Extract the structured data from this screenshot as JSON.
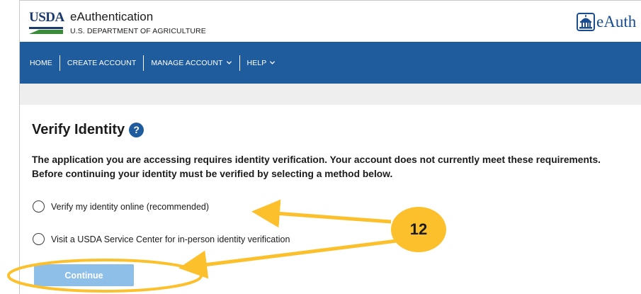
{
  "header": {
    "logo_text": "USDA",
    "app_title": "eAuthentication",
    "department": "U.S. DEPARTMENT OF AGRICULTURE",
    "brand_text": "eAuth",
    "brand_icon": "capitol-dome-icon"
  },
  "nav": {
    "items": [
      {
        "label": "HOME",
        "has_dropdown": false
      },
      {
        "label": "CREATE ACCOUNT",
        "has_dropdown": false
      },
      {
        "label": "MANAGE ACCOUNT",
        "has_dropdown": true
      },
      {
        "label": "HELP",
        "has_dropdown": true
      }
    ]
  },
  "main": {
    "title": "Verify Identity",
    "help_icon_glyph": "?",
    "intro": "The application you are accessing requires identity verification. Your account does not currently meet these requirements. Before continuing your identity must be verified by selecting a method below.",
    "options": [
      {
        "label": "Verify my identity online (recommended)",
        "selected": false
      },
      {
        "label": "Visit a USDA Service Center for in-person identity verification",
        "selected": false
      }
    ],
    "continue_label": "Continue"
  },
  "annotation": {
    "step_number": "12"
  },
  "colors": {
    "nav_bg": "#1f5c9e",
    "usda_navy": "#1a3a6e",
    "usda_green": "#3a8b3a",
    "button_disabled": "#8dbfe8",
    "annotation_gold": "#fcc02c",
    "grey_band": "#eeeeee"
  }
}
